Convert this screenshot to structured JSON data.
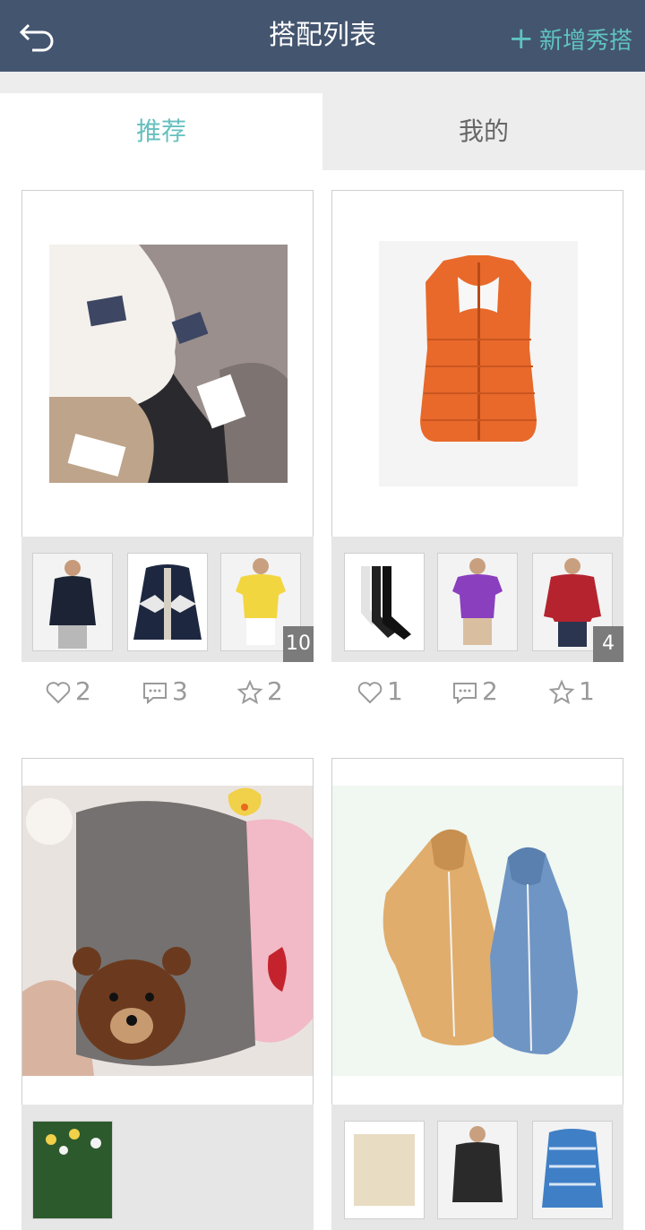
{
  "header": {
    "title": "搭配列表",
    "add_label": "新增秀搭"
  },
  "tabs": [
    {
      "label": "推荐",
      "active": true
    },
    {
      "label": "我的",
      "active": false
    }
  ],
  "colors": {
    "header_bg": "#44556f",
    "accent": "#5ec3c1"
  },
  "outfits": [
    {
      "main_image": "white-grey-scarves",
      "thumbs": [
        "man-navy-jacket",
        "patterned-cardigan",
        "yellow-tshirt"
      ],
      "item_count": "10",
      "likes": "2",
      "comments": "3",
      "favorites": "2"
    },
    {
      "main_image": "orange-puffer-vest",
      "thumbs": [
        "socks",
        "purple-polo",
        "red-sweater"
      ],
      "item_count": "4",
      "likes": "1",
      "comments": "2",
      "favorites": "1"
    },
    {
      "main_image": "grey-bear-glove",
      "thumbs": [
        "flowers"
      ]
    },
    {
      "main_image": "two-hoodies",
      "thumbs": [
        "beige-item",
        "man-dark",
        "blue-shirt"
      ]
    }
  ]
}
